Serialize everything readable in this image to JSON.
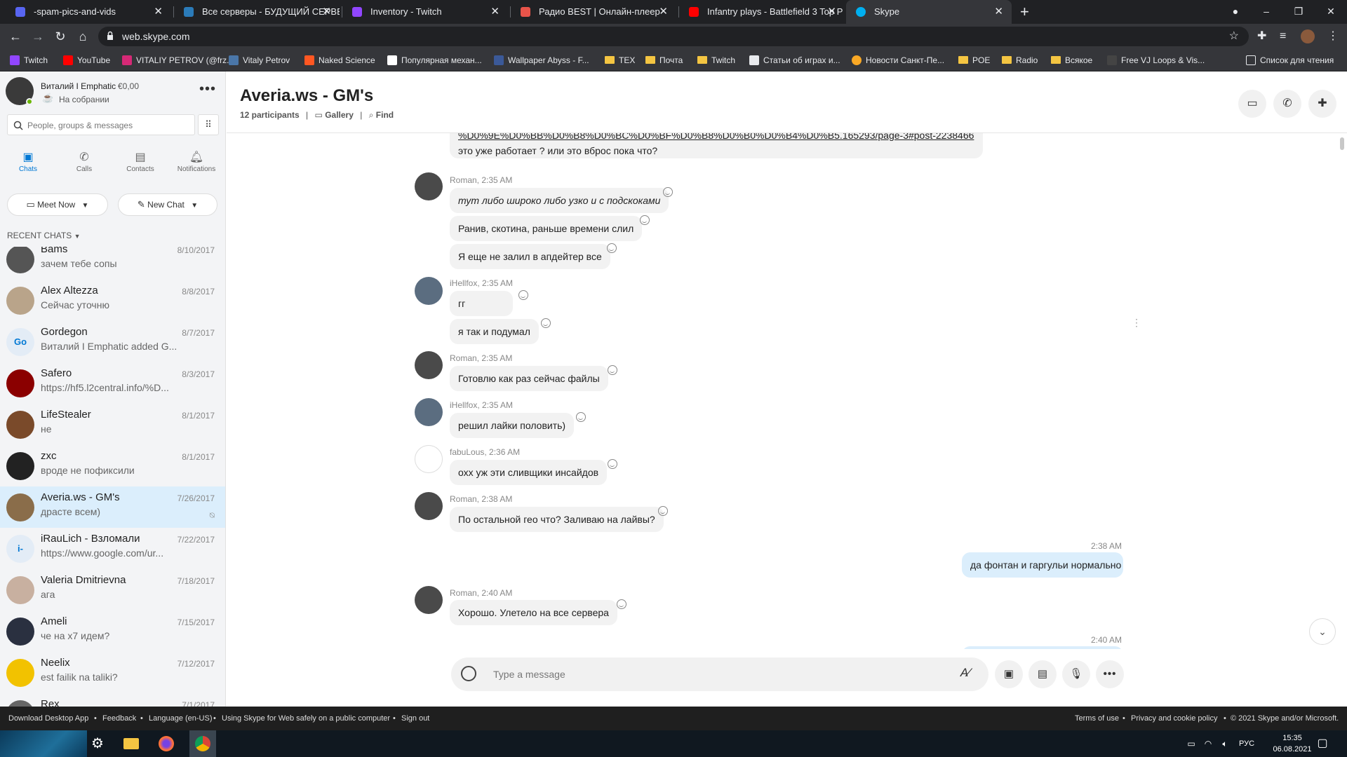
{
  "browser": {
    "tabs": [
      {
        "title": "-spam-pics-and-vids",
        "color": "#5865f2"
      },
      {
        "title": "Все серверы - БУДУЩИЙ СЕРВЕ",
        "color": "#2b7bb9"
      },
      {
        "title": "Inventory - Twitch",
        "color": "#9146ff"
      },
      {
        "title": "Радио BEST | Онлайн-плеер",
        "color": "#e8544a"
      },
      {
        "title": "Infantry plays - Battlefield 3 Top P",
        "color": "#ff0000"
      },
      {
        "title": "Skype",
        "color": "#00aff0"
      }
    ],
    "url": "web.skype.com",
    "bookmarks": [
      "Twitch",
      "YouTube",
      "VITALIY PETROV (@frz...",
      "Vitaly Petrov",
      "Naked Science",
      "Популярная механ...",
      "Wallpaper Abyss - F...",
      "TEX",
      "Почта",
      "Twitch",
      "Статьи об играх и...",
      "Новости Санкт-Пе...",
      "POE",
      "Radio",
      "Всякое",
      "Free VJ Loops & Vis...",
      "Список для чтения"
    ]
  },
  "profile": {
    "name": "Виталий I Emphatic",
    "balance": "€0,00",
    "status": "На собрании"
  },
  "search": {
    "placeholder": "People, groups & messages"
  },
  "nav": {
    "chats": "Chats",
    "calls": "Calls",
    "contacts": "Contacts",
    "notifications": "Notifications"
  },
  "buttons": {
    "meet_now": "Meet Now",
    "new_chat": "New Chat"
  },
  "recent_label": "RECENT CHATS",
  "chats": [
    {
      "name": "Bams",
      "msg": "зачем тебе сопы",
      "date": "8/10/2017"
    },
    {
      "name": "Alex Altezza",
      "msg": "Сейчас уточню",
      "date": "8/8/2017"
    },
    {
      "name": "Gordegon",
      "msg": "Виталий I Emphatic added G...",
      "date": "8/7/2017",
      "initials": "Go"
    },
    {
      "name": "Safero",
      "msg": "https://hf5.l2central.info/%D...",
      "date": "8/3/2017"
    },
    {
      "name": "LifeStealer",
      "msg": "не",
      "date": "8/1/2017"
    },
    {
      "name": "zxc",
      "msg": "вроде не пофиксили",
      "date": "8/1/2017"
    },
    {
      "name": "Averia.ws - GM's",
      "msg": "драсте всем)",
      "date": "7/26/2017"
    },
    {
      "name": "iRauLich - Взломали",
      "msg": "https://www.google.com/ur...",
      "date": "7/22/2017",
      "initials": "i-"
    },
    {
      "name": "Valeria Dmitrievna",
      "msg": "ага",
      "date": "7/18/2017"
    },
    {
      "name": "Ameli",
      "msg": "че на х7 идем?",
      "date": "7/15/2017"
    },
    {
      "name": "Neelix",
      "msg": "est failik na taliki?",
      "date": "7/12/2017"
    },
    {
      "name": "Rex",
      "msg": "",
      "date": "7/1/2017"
    }
  ],
  "conversation": {
    "title": "Averia.ws - GM's",
    "participants": "12 participants",
    "gallery": "Gallery",
    "find": "Find",
    "link_tail": "%D0%9E%D0%BB%D0%B8%D0%BC%D0%BF%D0%B8%D0%B0%D0%B4%D0%B5.165293/page-3#post-2238466",
    "link_msg": "это уже работает ? или это вброс пока что?",
    "senders": {
      "s1": "Roman, 2:35 AM",
      "s2": "iHellfox, 2:35 AM",
      "s3": "Roman, 2:35 AM",
      "s4": "iHellfox, 2:35 AM",
      "s5": "fabuLous, 2:36 AM",
      "s6": "Roman, 2:38 AM",
      "s7": "Roman, 2:40 AM"
    },
    "messages": {
      "m1": "тут либо широко либо узко и с подскоками",
      "m2": "Ранив, скотина, раньше времени слил",
      "m3": "Я еще не залил в апдейтер все",
      "m4": "гг",
      "m5": "я так и подумал",
      "m6": "Готовлю как раз сейчас файлы",
      "m7": "решил лайки половить)",
      "m8": "охх уж эти сливщики инсайдов",
      "m9": "По остальной гео что? Заливаю на лайвы?",
      "mine1": "да фонтан и гаргульи нормально",
      "m10": "Хорошо. Улетело на все сервера"
    },
    "times": {
      "mine1": "2:38 AM",
      "mine2": "2:40 AM"
    },
    "composer_placeholder": "Type a message"
  },
  "footer": {
    "download": "Download Desktop App",
    "feedback": "Feedback",
    "language": "Language (en-US)",
    "public": "Using Skype for Web safely on a public computer",
    "signout": "Sign out",
    "terms": "Terms of use",
    "privacy": "Privacy and cookie policy",
    "copyright": "© 2021 Skype and/or Microsoft."
  },
  "taskbar": {
    "lang": "РУС",
    "time": "15:35",
    "date": "06.08.2021"
  },
  "colors": {
    "accent": "#0078d4",
    "selected_chat": "#dbeefc",
    "bubble_mine": "#dbeefc",
    "bubble_other": "#f2f2f2"
  }
}
